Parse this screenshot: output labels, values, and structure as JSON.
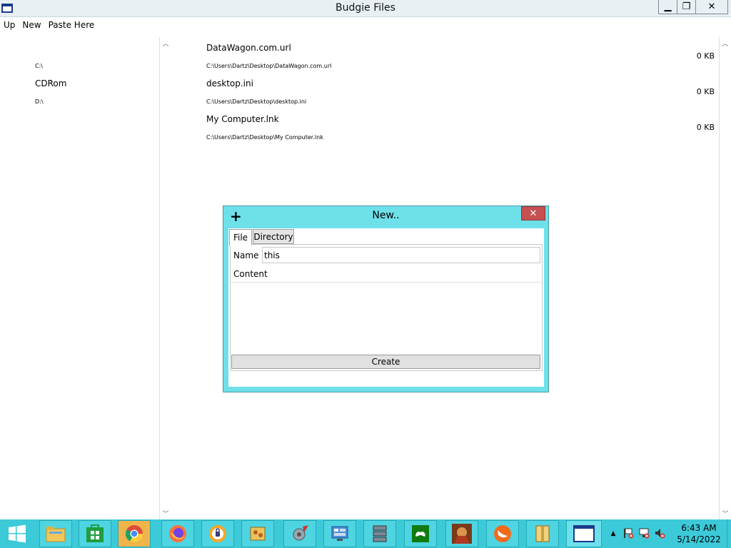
{
  "window": {
    "title": "Budgie Files",
    "min_glyph": "▁",
    "max_glyph": "❐",
    "close_glyph": "✕"
  },
  "menu": {
    "items": [
      "Up",
      "New",
      "Paste Here"
    ]
  },
  "drives": [
    {
      "name": "",
      "path": "C:\\"
    },
    {
      "name": "CDRom",
      "path": "D:\\"
    }
  ],
  "files": [
    {
      "name": "DataWagon.com.url",
      "path": "C:\\Users\\Dartz\\Desktop\\DataWagon.com.url",
      "size": "0 KB"
    },
    {
      "name": "desktop.ini",
      "path": "C:\\Users\\Dartz\\Desktop\\desktop.ini",
      "size": "0 KB"
    },
    {
      "name": "My Computer.lnk",
      "path": "C:\\Users\\Dartz\\Desktop\\My Computer.lnk",
      "size": "0 KB"
    }
  ],
  "dialog": {
    "title": "New..",
    "plus_glyph": "+",
    "close_glyph": "✕",
    "tabs": [
      "File",
      "Directory"
    ],
    "name_label": "Name",
    "name_value": "this",
    "content_label": "Content",
    "create_label": "Create"
  },
  "taskbar": {
    "clock_time": "6:43 AM",
    "clock_date": "5/14/2022",
    "tray_arrow": "▲"
  },
  "colors": {
    "accent": "#3cc9d8",
    "dialog": "#6ee0ea",
    "close_red": "#c75050"
  }
}
